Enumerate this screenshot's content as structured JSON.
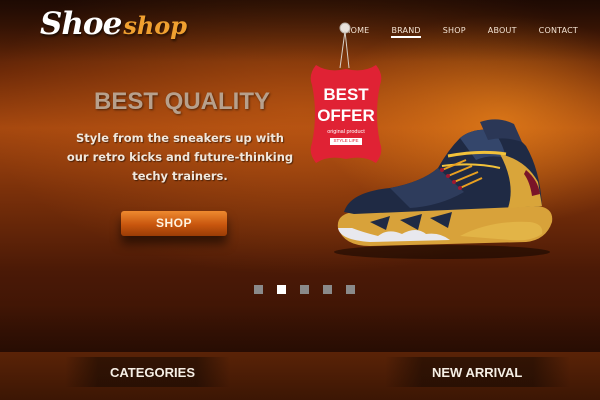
{
  "brand": {
    "logo_main": "Shoe",
    "logo_accent": "shop"
  },
  "nav": {
    "items": [
      {
        "label": "HOME"
      },
      {
        "label": "BRAND"
      },
      {
        "label": "SHOP"
      },
      {
        "label": "ABOUT"
      },
      {
        "label": "CONTACT"
      }
    ],
    "active_label": "BRAND"
  },
  "hero": {
    "headline": "BEST QUALITY",
    "subtext": "Style from the sneakers up with our retro kicks and future-thinking techy trainers.",
    "button_label": "SHOP",
    "slider": {
      "total": 5,
      "active_index": 2
    }
  },
  "tag": {
    "line1": "BEST",
    "line2": "OFFER",
    "line3": "original product",
    "line4": "STYLE LIFE",
    "color": "#e02234"
  },
  "sections": {
    "categories": "CATEGORIES",
    "new_arrival": "NEW ARRIVAL"
  },
  "colors": {
    "accent": "#f0a030",
    "button": "#d8661a"
  }
}
